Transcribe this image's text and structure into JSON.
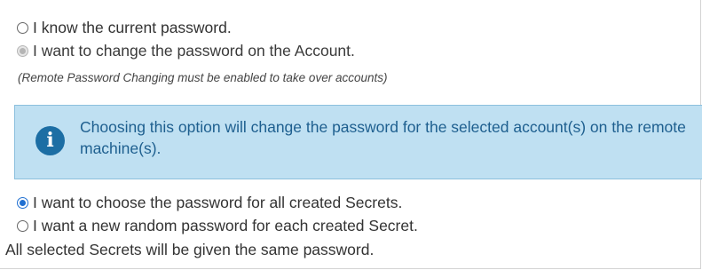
{
  "password_source": {
    "options": [
      {
        "label": "I know the current password.",
        "state": "unchecked"
      },
      {
        "label": "I want to change the password on the Account.",
        "state": "disabled-selected"
      }
    ],
    "note": "(Remote Password Changing must be enabled to take over accounts)"
  },
  "info_box": {
    "icon": "info-icon",
    "icon_glyph": "i",
    "text": "Choosing this option will change the password for the selected account(s) on the remote machine(s).",
    "colors": {
      "background": "#bfe0f2",
      "icon": "#1c6ea4",
      "text": "#1e5f8f"
    }
  },
  "password_choice": {
    "options": [
      {
        "label": "I want to choose the password for all created Secrets.",
        "state": "checked"
      },
      {
        "label": "I want a new random password for each created Secret.",
        "state": "unchecked"
      }
    ],
    "footer": "All selected Secrets will be given the same password."
  },
  "accent_color": "#1f6fd1"
}
